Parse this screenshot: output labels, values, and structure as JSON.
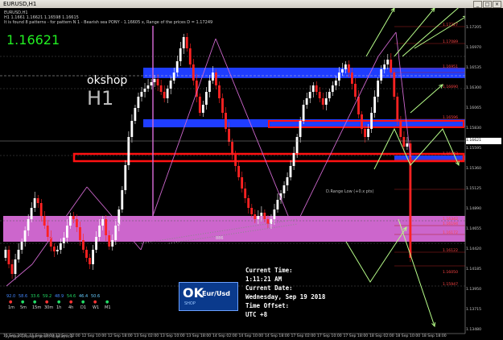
{
  "window": {
    "title": "EURUSD,H1",
    "buttons": [
      "_",
      "□",
      "×"
    ]
  },
  "info_lines": [
    "EURUSD,H1",
    "H1  1.1661 1.16621 1.16598 1.16615",
    "It is found 8 patterns  -  for pattern N 1 - Bearish sea PONY  - 1.16605 x, Range of the prices D = 1.17249"
  ],
  "big_price": "1.16621",
  "brand": "okshop",
  "timeframe_label": "H1",
  "clock": {
    "line1": "Current Time:",
    "line2": "1:11:21 AM",
    "line3": "Current Date:",
    "line4": "Wednesday, Sep 19 2018",
    "line5": "Time Offset:",
    "line6": "UTC +8"
  },
  "logo": {
    "ok": "OK",
    "shop": "SHOP",
    "pair": "Eur/Usd"
  },
  "strength": {
    "values": [
      "92.0",
      "58.6",
      "33.6",
      "59.2",
      "48.9",
      "54.6",
      "46.4",
      "50.6"
    ],
    "timeframes": [
      "1m",
      "5m",
      "15m",
      "30m",
      "1h",
      "4h",
      "D1",
      "W1",
      "M1"
    ]
  },
  "annotation_886": "886",
  "range_label": "D.Range Low (+0.x pts)",
  "footer_label": "Symbol Changer profit display v.2",
  "x_labels": [
    "11 Sep 2018",
    "11 Sep 22:00",
    "12 Sep 02:00",
    "12 Sep 10:00",
    "12 Sep 18:00",
    "13 Sep 02:00",
    "13 Sep 10:00",
    "13 Sep 18:00",
    "14 Sep 02:00",
    "14 Sep 10:00",
    "14 Sep 18:00",
    "17 Sep 02:00",
    "17 Sep 10:00",
    "17 Sep 18:00",
    "18 Sep 02:00",
    "18 Sep 10:00",
    "18 Sep 18:00"
  ],
  "y_labels": [
    "1.17205",
    "1.16970",
    "1.16535",
    "1.16300",
    "1.16065",
    "1.15830",
    "1.15595",
    "1.15360",
    "1.15125",
    "1.14890",
    "1.14655",
    "1.14420",
    "1.14185",
    "1.13950",
    "1.13715",
    "1.13480"
  ],
  "level_labels": [
    "1.17227",
    "1.17089",
    "1.16951",
    "1.16690",
    "1.16596",
    "1.16543",
    "1.16342",
    "1.16194",
    "1.16172",
    "1.16122",
    "1.16050",
    "1.15947"
  ],
  "colors": {
    "background": "#000000",
    "bull_candle": "#ffffff",
    "bear_candle": "#ff2222",
    "blue_zone": "#1f3dff",
    "magenta_zone": "#cc66cc",
    "pattern_line": "#cc66cc",
    "arrows": "#b8ff8a",
    "price_green": "#22ee22"
  }
}
